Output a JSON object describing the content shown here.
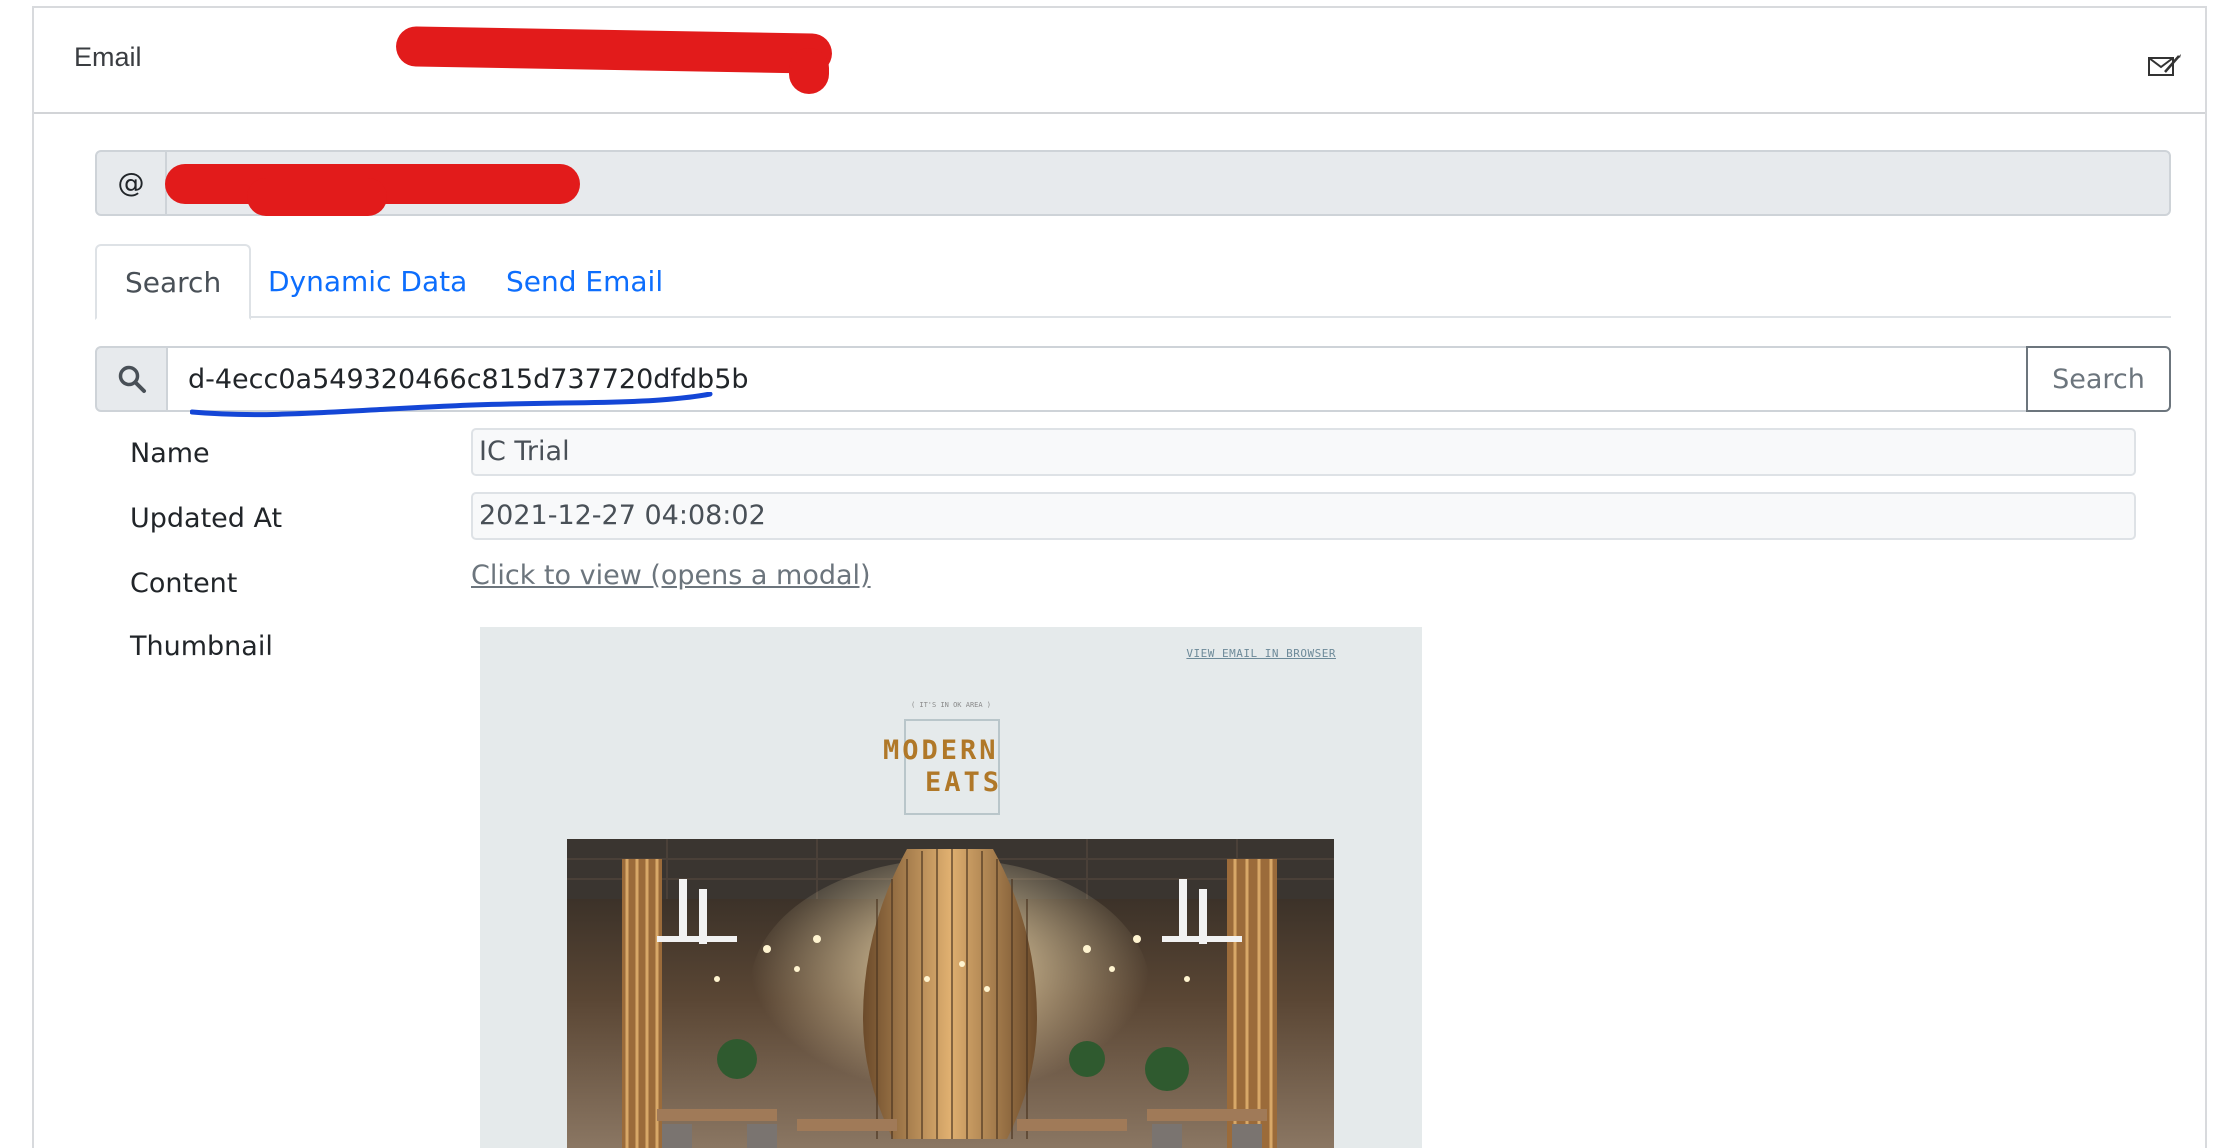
{
  "header": {
    "title": "Email"
  },
  "address_group": {
    "prefix": "@"
  },
  "tabs": [
    {
      "label": "Search"
    },
    {
      "label": "Dynamic Data"
    },
    {
      "label": "Send Email"
    }
  ],
  "search": {
    "value": "d-4ecc0a549320466c815d737720dfdb5b",
    "button_label": "Search"
  },
  "details": {
    "name_label": "Name",
    "name_value": "IC Trial",
    "updated_label": "Updated At",
    "updated_value": "2021-12-27 04:08:02",
    "content_label": "Content",
    "content_link": "Click to view (opens a modal)",
    "thumbnail_label": "Thumbnail"
  },
  "thumbnail": {
    "view_in_browser": "VIEW EMAIL IN BROWSER",
    "tagline": "( IT'S IN OK AREA )",
    "logo_line1": "MODERN",
    "logo_line2": "EATS"
  },
  "colors": {
    "link_blue": "#0d6efd",
    "redaction_red": "#e21b1b",
    "annotation_blue": "#1446d6",
    "logo_gold": "#b07828"
  },
  "icons": {
    "header_action": "envelope-pencil-icon",
    "search_addon": "search-icon"
  }
}
